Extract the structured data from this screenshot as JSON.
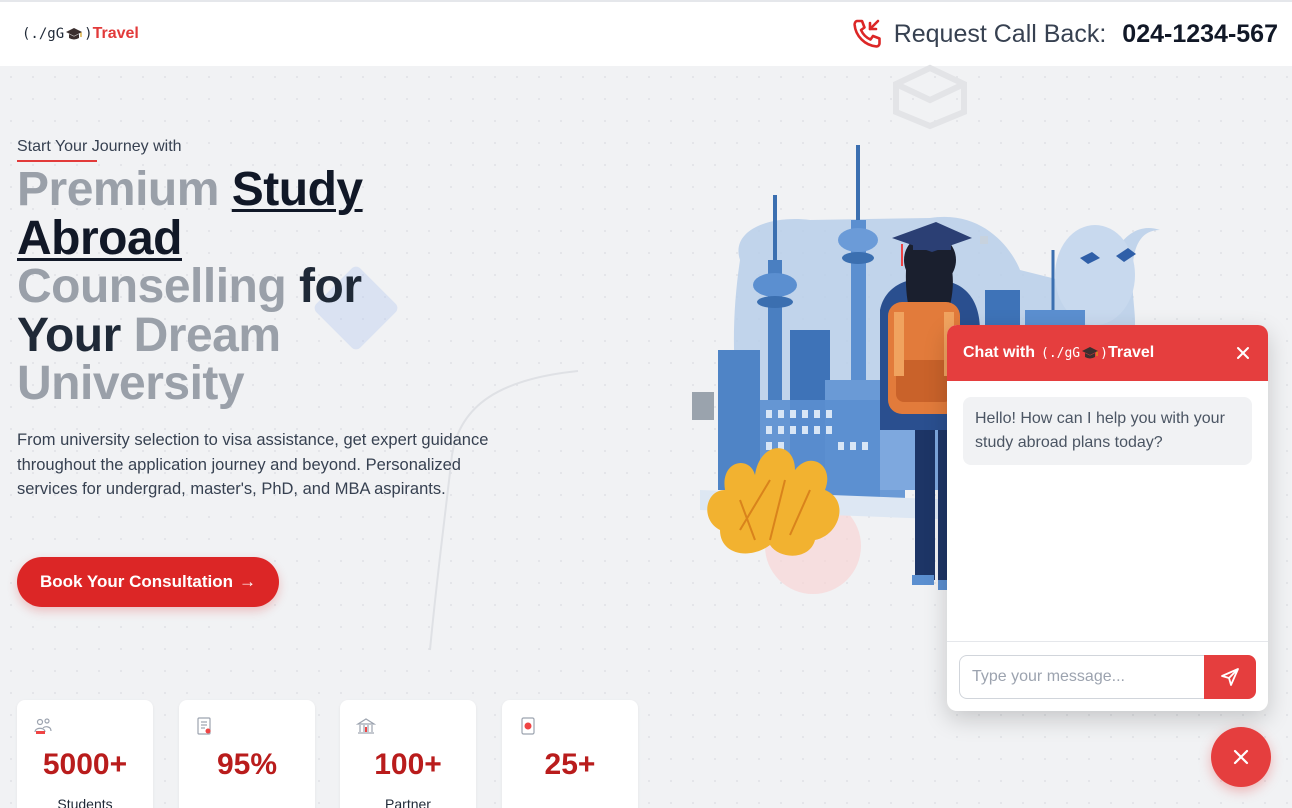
{
  "header": {
    "logo_code_open": "(./gG",
    "logo_code_close": ")",
    "logo_brand": "Travel",
    "callback_label": "Request Call Back:",
    "callback_number": "024-1234-567"
  },
  "hero": {
    "eyebrow": "Start Your Journey with",
    "title": {
      "w1": "Premium",
      "w2": "Study",
      "w3": "Abroad",
      "w4": "Counselling",
      "w5": "for",
      "w6": "Your",
      "w7": "Dream",
      "w8": "University"
    },
    "description": "From university selection to visa assistance, get expert guidance throughout the application journey and beyond. Personalized services for undergrad, master's, PhD, and MBA aspirants.",
    "cta_label": "Book Your Consultation",
    "cta_arrow": "→"
  },
  "stats": [
    {
      "icon": "students-icon",
      "value": "5000+",
      "label": "Students"
    },
    {
      "icon": "document-icon",
      "value": "95%",
      "label": ""
    },
    {
      "icon": "building-icon",
      "value": "100+",
      "label": "Partner"
    },
    {
      "icon": "passport-icon",
      "value": "25+",
      "label": ""
    }
  ],
  "chat": {
    "title_prefix": "Chat with",
    "title_code_open": "(./gG",
    "title_code_close": ")",
    "title_brand": "Travel",
    "greeting": "Hello! How can I help you with your study abroad plans today?",
    "input_placeholder": "Type your message..."
  },
  "colors": {
    "accent": "#dc2626",
    "chat_header": "#e53e3e",
    "stat_value": "#b91c1c"
  }
}
